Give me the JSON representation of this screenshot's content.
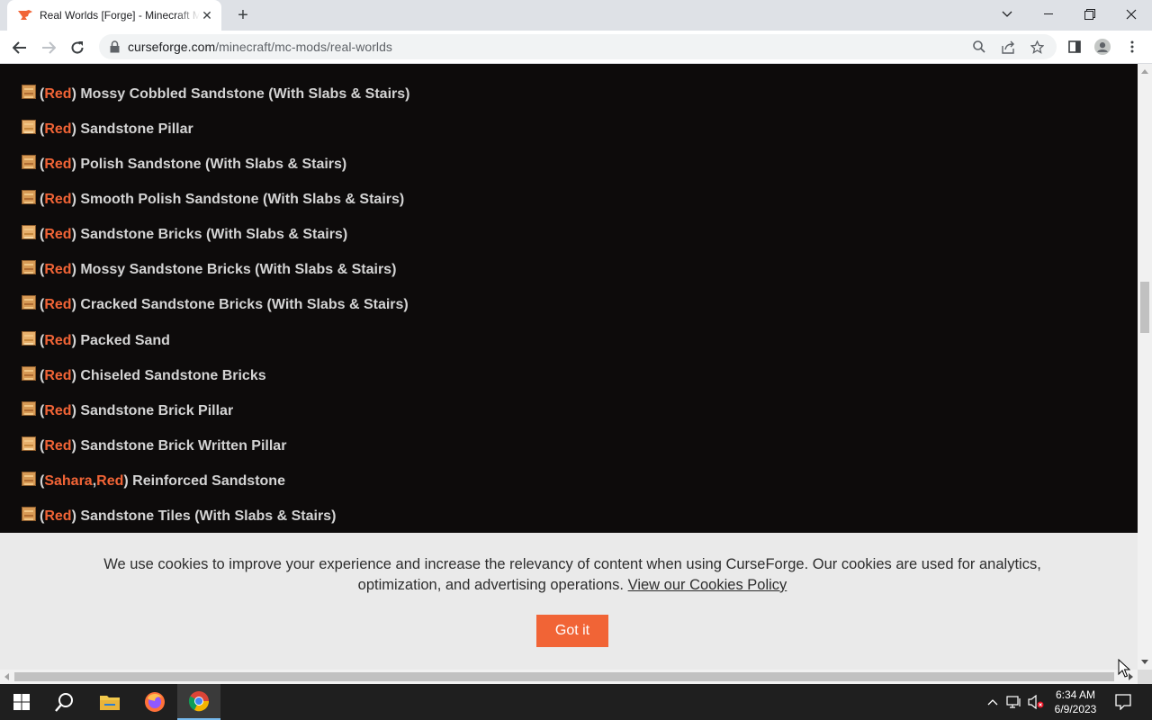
{
  "browser": {
    "tab_title": "Real Worlds [Forge] - Minecraft Mods - CurseForge",
    "tab_close": "✕",
    "new_tab": "+",
    "url_host": "curseforge.com",
    "url_path": "/minecraft/mc-mods/real-worlds"
  },
  "list": {
    "items": [
      {
        "tags": [
          "Red"
        ],
        "label": " Mossy Cobbled Sandstone (With Slabs & Stairs)"
      },
      {
        "tags": [
          "Red"
        ],
        "label": " Sandstone Pillar"
      },
      {
        "tags": [
          "Red"
        ],
        "label": " Polish Sandstone (With Slabs & Stairs)"
      },
      {
        "tags": [
          "Red"
        ],
        "label": " Smooth Polish Sandstone (With Slabs & Stairs)"
      },
      {
        "tags": [
          "Red"
        ],
        "label": " Sandstone Bricks (With Slabs & Stairs)"
      },
      {
        "tags": [
          "Red"
        ],
        "label": " Mossy Sandstone Bricks (With Slabs & Stairs)"
      },
      {
        "tags": [
          "Red"
        ],
        "label": " Cracked Sandstone Bricks (With Slabs & Stairs)"
      },
      {
        "tags": [
          "Red"
        ],
        "label": " Packed Sand"
      },
      {
        "tags": [
          "Red"
        ],
        "label": " Chiseled Sandstone Bricks"
      },
      {
        "tags": [
          "Red"
        ],
        "label": " Sandstone Brick Pillar"
      },
      {
        "tags": [
          "Red"
        ],
        "label": " Sandstone Brick Written Pillar"
      },
      {
        "tags": [
          "Sahara",
          "Red"
        ],
        "label": " Reinforced Sandstone"
      },
      {
        "tags": [
          "Red"
        ],
        "label": " Sandstone Tiles (With Slabs & Stairs)"
      }
    ]
  },
  "cookie": {
    "text": "We use cookies to improve your experience and increase the relevancy of content when using CurseForge. Our cookies are used for analytics, optimization, and advertising operations.",
    "link": "View our Cookies Policy",
    "button": "Got it"
  },
  "taskbar": {
    "time": "6:34 AM",
    "date": "6/9/2023"
  },
  "colors": {
    "accent": "#f16436",
    "page_bg": "#0d0b0b",
    "text": "#d4d4d4"
  }
}
